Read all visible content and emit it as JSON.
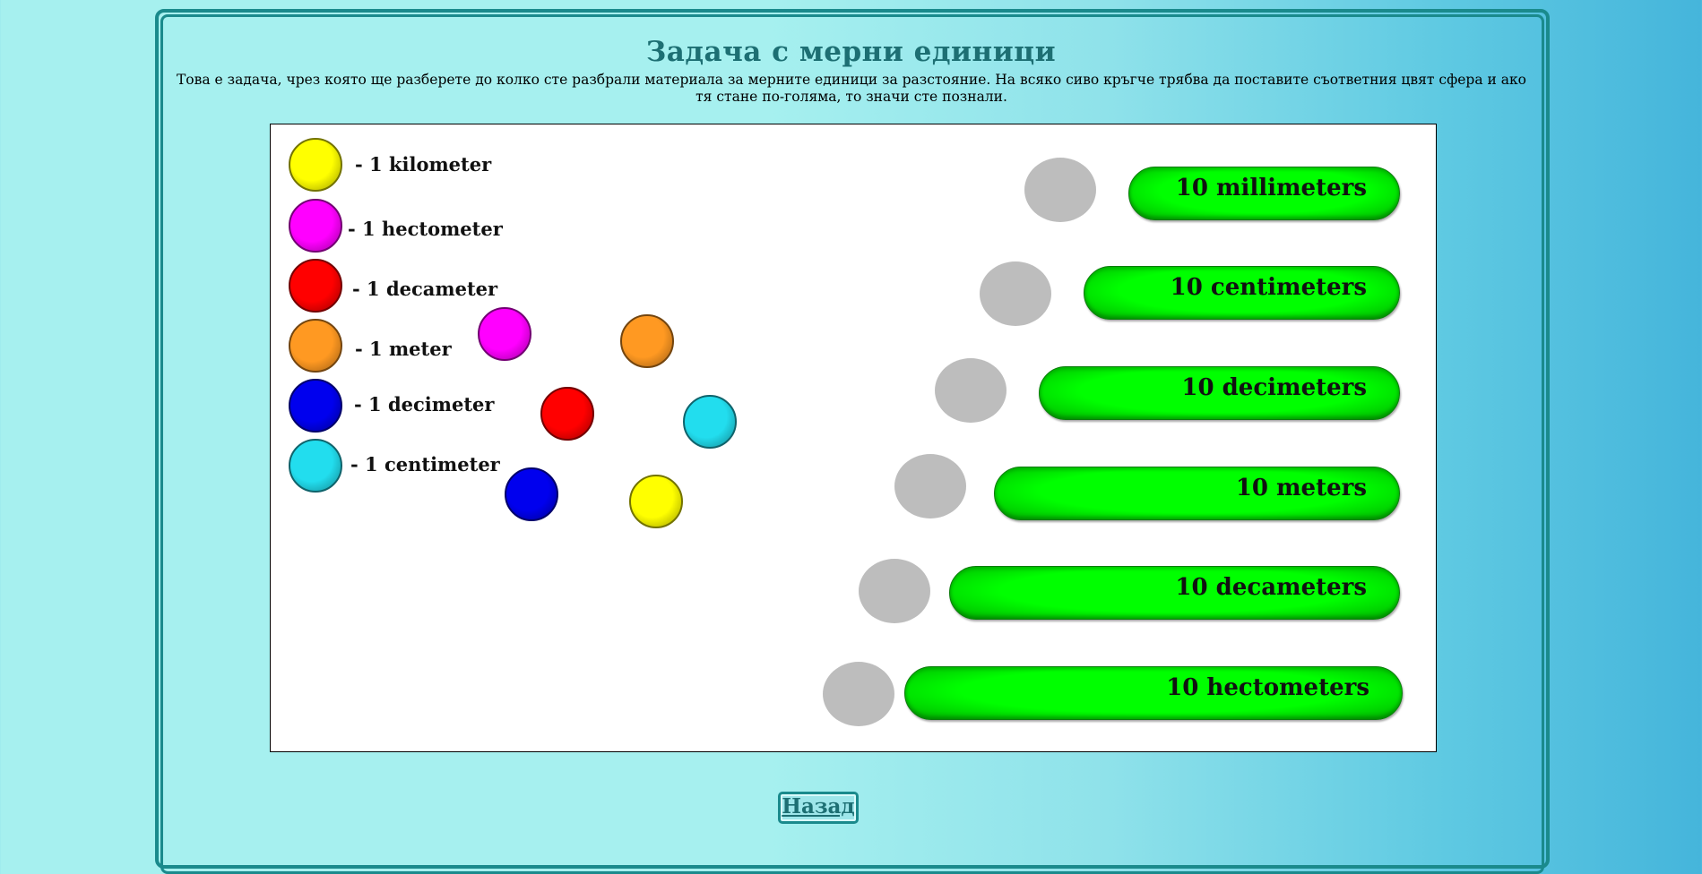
{
  "header": {
    "title": "Задача с мерни единици",
    "intro": "Това е задача, чрез която ще разберете до колко сте разбрали материала за мерните единици за разстояние. На всяко сиво кръгче трябва да поставите съответния цвят сфера и ако тя стане по-голяма, то значи сте познали."
  },
  "legend": [
    {
      "label": "- 1 kilometer",
      "color": "#ffff00"
    },
    {
      "label": "- 1 hectometer",
      "color": "#ff00ff"
    },
    {
      "label": "- 1 decameter",
      "color": "#ff0000"
    },
    {
      "label": "- 1 meter",
      "color": "#ff9922"
    },
    {
      "label": "- 1 decimeter",
      "color": "#0000ee"
    },
    {
      "label": "- 1 centimeter",
      "color": "#22ddee"
    }
  ],
  "draggable_spheres": [
    {
      "color_name": "magenta",
      "color": "#ff00ff"
    },
    {
      "color_name": "orange",
      "color": "#ff9922"
    },
    {
      "color_name": "red",
      "color": "#ff0000"
    },
    {
      "color_name": "cyan",
      "color": "#22ddee"
    },
    {
      "color_name": "blue",
      "color": "#0000ee"
    },
    {
      "color_name": "yellow",
      "color": "#ffff00"
    }
  ],
  "targets": [
    {
      "label": "10 millimeters"
    },
    {
      "label": "10 centimeters"
    },
    {
      "label": "10 decimeters"
    },
    {
      "label": "10 meters"
    },
    {
      "label": "10 decameters"
    },
    {
      "label": "10 hectometers"
    }
  ],
  "footer": {
    "back_label": "Назад"
  },
  "colors": {
    "accent": "#1a8a8c",
    "bar_green": "#00ff00",
    "target_gray": "#bdbdbd"
  }
}
